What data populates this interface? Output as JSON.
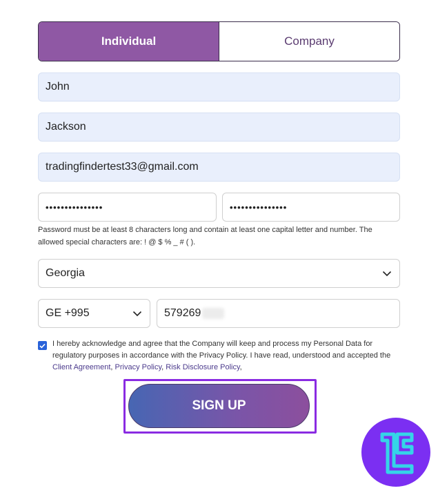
{
  "account_type_tabs": [
    {
      "label": "Individual",
      "active": true
    },
    {
      "label": "Company",
      "active": false
    }
  ],
  "form": {
    "first_name": "John",
    "last_name": "Jackson",
    "email": "tradingfindertest33@gmail.com",
    "password_masked": "•••••••••••••••",
    "confirm_password_masked": "•••••••••••••••",
    "password_hint": "Password must be at least 8 characters long and contain at least one capital letter and number. The allowed special characters are: ! @ $ % _ # ( ).",
    "country": "Georgia",
    "phone_code": "GE +995",
    "phone_number": "579269"
  },
  "consent": {
    "checked": true,
    "text": "I hereby acknowledge and agree that the Company will keep and process my Personal Data for regulatory purposes in accordance with the Privacy Policy. I have read, understood and accepted the ",
    "link_client_agreement": "Client Agreement",
    "sep1": ", ",
    "link_privacy_policy": "Privacy Policy",
    "sep2": ", ",
    "link_risk_disclosure": "Risk Disclosure Policy",
    "sep3": ","
  },
  "signup_label": "SIGN UP",
  "colors": {
    "tab_active": "#8f58a4",
    "field_filled": "#e9effc",
    "button_gradient_start": "#4766b3",
    "button_gradient_end": "#8c4f9d",
    "highlight_frame": "#8a2be2",
    "logo_bg": "#7b2ff2",
    "logo_fg": "#35d4e8"
  }
}
